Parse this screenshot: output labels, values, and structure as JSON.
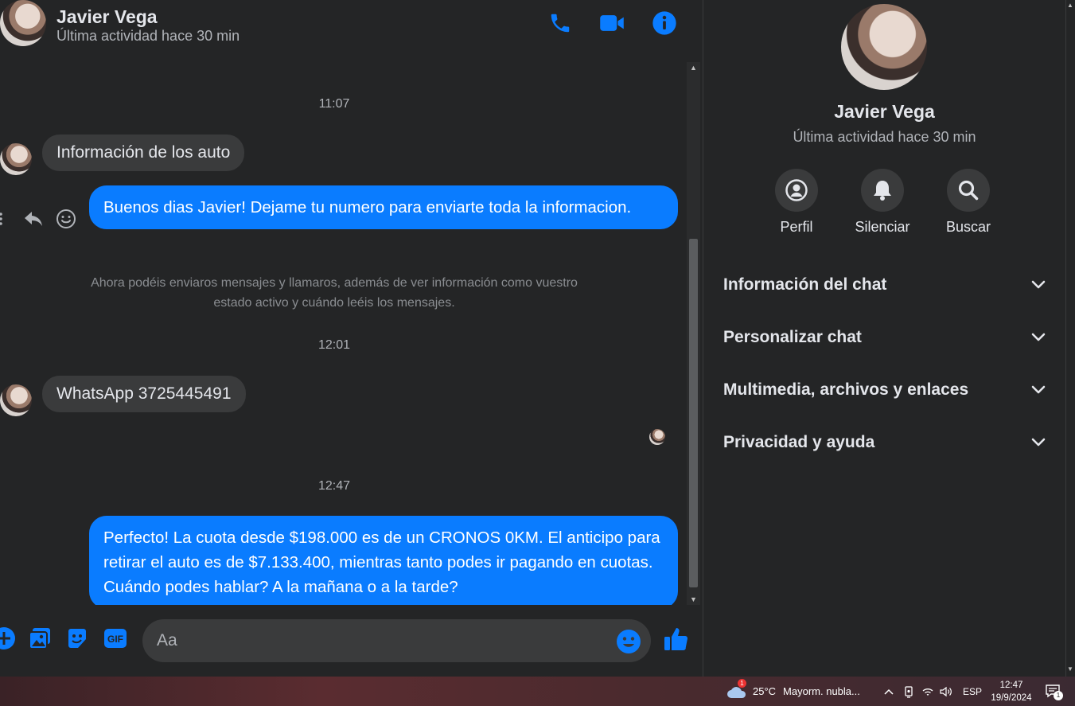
{
  "contact": {
    "name": "Javier Vega",
    "status": "Última actividad hace 30 min"
  },
  "accent_color": "#0a7cff",
  "messages": {
    "time1": "11:07",
    "in1": "Información de los auto",
    "out1": "Buenos dias Javier! Dejame tu numero para enviarte toda la informacion.",
    "system": "Ahora podéis enviaros mensajes y llamaros, además de ver información como vuestro estado activo y cuándo leéis los mensajes.",
    "time2": "12:01",
    "in2": "WhatsApp 3725445491",
    "time3": "12:47",
    "out2": "Perfecto! La cuota desde $198.000 es de un CRONOS 0KM. El anticipo para retirar el auto es de $7.133.400, mientras tanto podes ir pagando en cuotas. Cuándo podes hablar? A la mañana o a la tarde?"
  },
  "composer": {
    "placeholder": "Aa"
  },
  "info_panel": {
    "actions": [
      {
        "label": "Perfil",
        "icon": "profile-icon"
      },
      {
        "label": "Silenciar",
        "icon": "bell-icon"
      },
      {
        "label": "Buscar",
        "icon": "search-icon"
      }
    ],
    "sections": [
      "Información del chat",
      "Personalizar chat",
      "Multimedia, archivos y enlaces",
      "Privacidad y ayuda"
    ]
  },
  "taskbar": {
    "weather_temp": "25°C",
    "weather_text": "Mayorm. nubla...",
    "weather_badge": "1",
    "language": "ESP",
    "time": "12:47",
    "date": "19/9/2024",
    "notification_count": "1"
  }
}
